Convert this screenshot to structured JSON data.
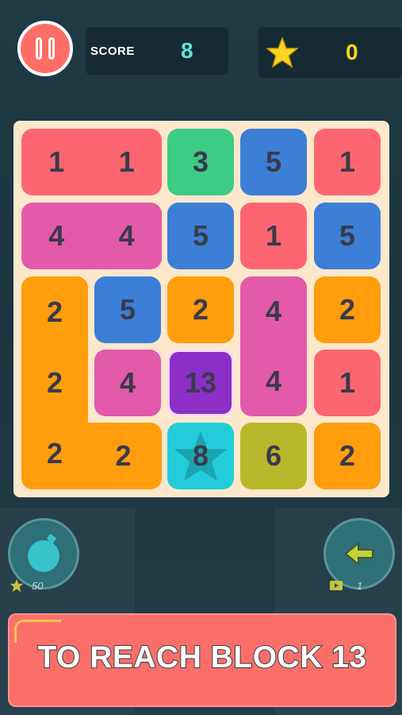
{
  "header": {
    "score_label": "SCORE",
    "score_value": "8",
    "stars_value": "0",
    "pause_icon": "pause-icon",
    "star_icon": "star-icon"
  },
  "board": {
    "rows": [
      [
        "1",
        "1",
        "3",
        "5",
        "1"
      ],
      [
        "4",
        "4",
        "5",
        "1",
        "5"
      ],
      [
        "2",
        "5",
        "2",
        "4",
        "2"
      ],
      [
        "2",
        "4",
        "13",
        "4",
        "1"
      ],
      [
        "2",
        "2",
        "8",
        "6",
        "2"
      ]
    ],
    "colors": {
      "red": "#fd6670",
      "green": "#3ccc84",
      "blue": "#3b7fd6",
      "pink": "#e25aa9",
      "orange": "#ff9d0c",
      "purple": "#8b2fc6",
      "cyan": "#22cdd9",
      "olive": "#b9b72c"
    },
    "tiles": [
      {
        "id": "t-r1-merged-1",
        "value": "1",
        "color": "red"
      },
      {
        "id": "t-r1c2",
        "value": "3",
        "color": "green"
      },
      {
        "id": "t-r1c3",
        "value": "5",
        "color": "blue"
      },
      {
        "id": "t-r1c4",
        "value": "1",
        "color": "red"
      },
      {
        "id": "t-r2-merged-4",
        "value": "4",
        "color": "pink"
      },
      {
        "id": "t-r2c2",
        "value": "5",
        "color": "blue"
      },
      {
        "id": "t-r2c3",
        "value": "1",
        "color": "red"
      },
      {
        "id": "t-r2c4",
        "value": "5",
        "color": "blue"
      },
      {
        "id": "t-orange-L-2",
        "value": "2",
        "color": "orange"
      },
      {
        "id": "t-r3c1",
        "value": "5",
        "color": "blue"
      },
      {
        "id": "t-r3c2",
        "value": "2",
        "color": "orange"
      },
      {
        "id": "t-pink-col-4",
        "value": "4",
        "color": "pink"
      },
      {
        "id": "t-r3c4",
        "value": "2",
        "color": "orange"
      },
      {
        "id": "t-r4c1",
        "value": "4",
        "color": "pink"
      },
      {
        "id": "t-r4c2",
        "value": "13",
        "color": "purple"
      },
      {
        "id": "t-r4c4",
        "value": "1",
        "color": "red"
      },
      {
        "id": "t-r5c2",
        "value": "8",
        "color": "cyan"
      },
      {
        "id": "t-r5c3",
        "value": "6",
        "color": "olive"
      },
      {
        "id": "t-r5c4",
        "value": "2",
        "color": "orange"
      }
    ]
  },
  "powerups": {
    "bomb_icon": "bomb-icon",
    "bomb_cost": "50",
    "undo_icon": "arrow-left-icon",
    "undo_count": "1",
    "video_icon": "video-icon"
  },
  "banner": {
    "text": "TO REACH BLOCK 13"
  }
}
